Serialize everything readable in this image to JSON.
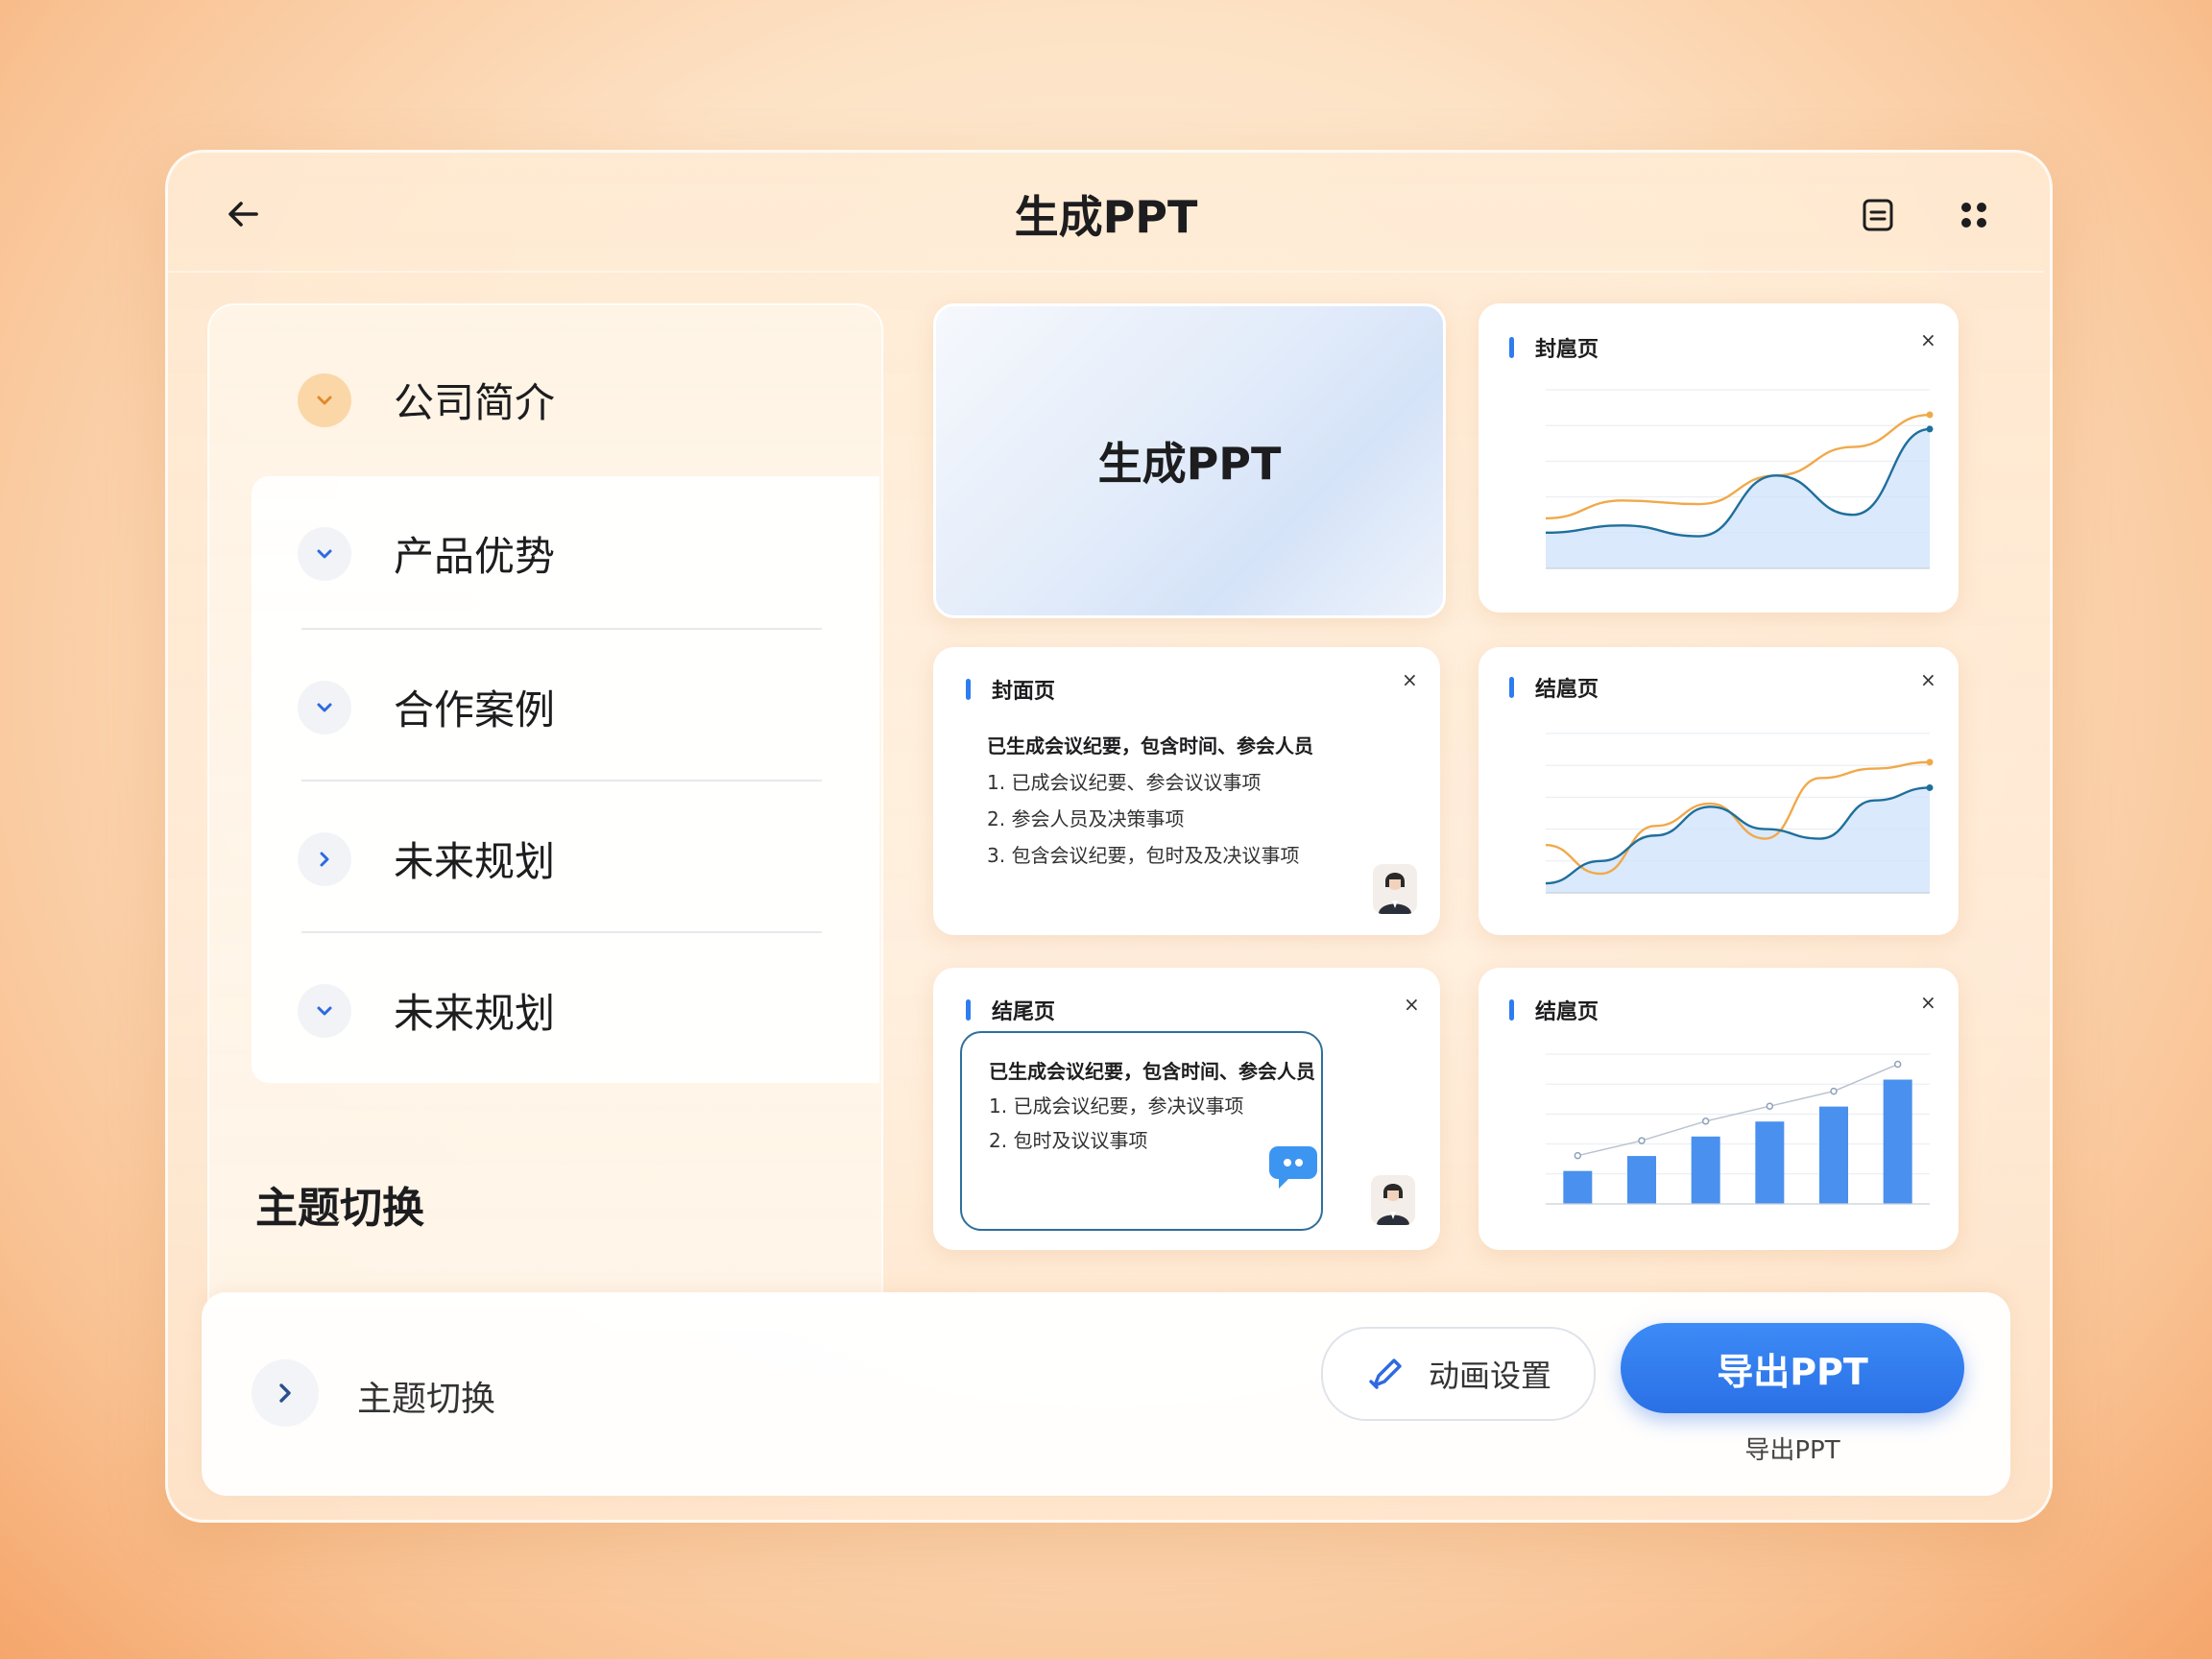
{
  "header": {
    "title": "生成PPT",
    "back_icon": "arrow-left-icon",
    "doc_icon": "document-icon",
    "more_icon": "four-dots-icon"
  },
  "sidebar": {
    "items": [
      {
        "label": "公司简介",
        "icon": "chevron-down-icon",
        "active": true
      },
      {
        "label": "产品优势",
        "icon": "chevron-down-icon"
      },
      {
        "label": "合作案例",
        "icon": "chevron-down-icon"
      },
      {
        "label": "未来规划",
        "icon": "chevron-right-icon"
      },
      {
        "label": "未来规划",
        "icon": "chevron-down-icon"
      }
    ],
    "section_title": "主题切换"
  },
  "slides": {
    "cover": {
      "title": "生成PPT"
    },
    "chart1": {
      "title": "封扈页",
      "close": "×"
    },
    "text1": {
      "title": "封面页",
      "close": "×",
      "heading": "已生成会议纪要，包含时间、参会人员",
      "lines": [
        "1. 已成会议纪要、参会议议事项",
        "2. 参会人员及决策事项",
        "3. 包含会议纪要，包时及及决议事项"
      ]
    },
    "chart2": {
      "title": "结扈页",
      "close": "×"
    },
    "text2": {
      "title": "结尾页",
      "close": "×",
      "heading": "已生成会议纪要，包含时间、参会人员",
      "lines": [
        "1. 已成会议纪要，参决议事项",
        "2. 包时及议议事项"
      ]
    },
    "chart3": {
      "title": "结扈页",
      "close": "×"
    }
  },
  "bottom": {
    "theme_label": "主题切换",
    "animation_label": "动画设置",
    "export_label": "导出PPT",
    "export_sub": "导出PPT"
  },
  "colors": {
    "accent": "#2e7cf0",
    "orange_line": "#f0a94a",
    "teal_line": "#1f6f9b",
    "active_chip": "#fbd7a8"
  },
  "chart_data": [
    {
      "type": "line",
      "title": "",
      "series": [
        {
          "values": [
            28,
            38,
            36,
            52,
            68,
            86
          ]
        },
        {
          "values": [
            20,
            24,
            18,
            52,
            30,
            78
          ]
        }
      ],
      "ylim": [
        0,
        100
      ],
      "grid": true
    },
    {
      "type": "line",
      "title": "",
      "series": [
        {
          "values": [
            30,
            12,
            42,
            56,
            34,
            72,
            78,
            82
          ]
        },
        {
          "values": [
            6,
            20,
            36,
            54,
            40,
            34,
            58,
            66
          ]
        }
      ],
      "ylim": [
        0,
        100
      ],
      "grid": true
    },
    {
      "type": "bar",
      "title": "",
      "values": [
        22,
        32,
        45,
        55,
        65,
        83
      ],
      "series": [
        {
          "values": [
            22,
            32,
            45,
            55,
            65,
            83
          ]
        }
      ],
      "ylim": [
        0,
        100
      ],
      "grid": true
    }
  ]
}
